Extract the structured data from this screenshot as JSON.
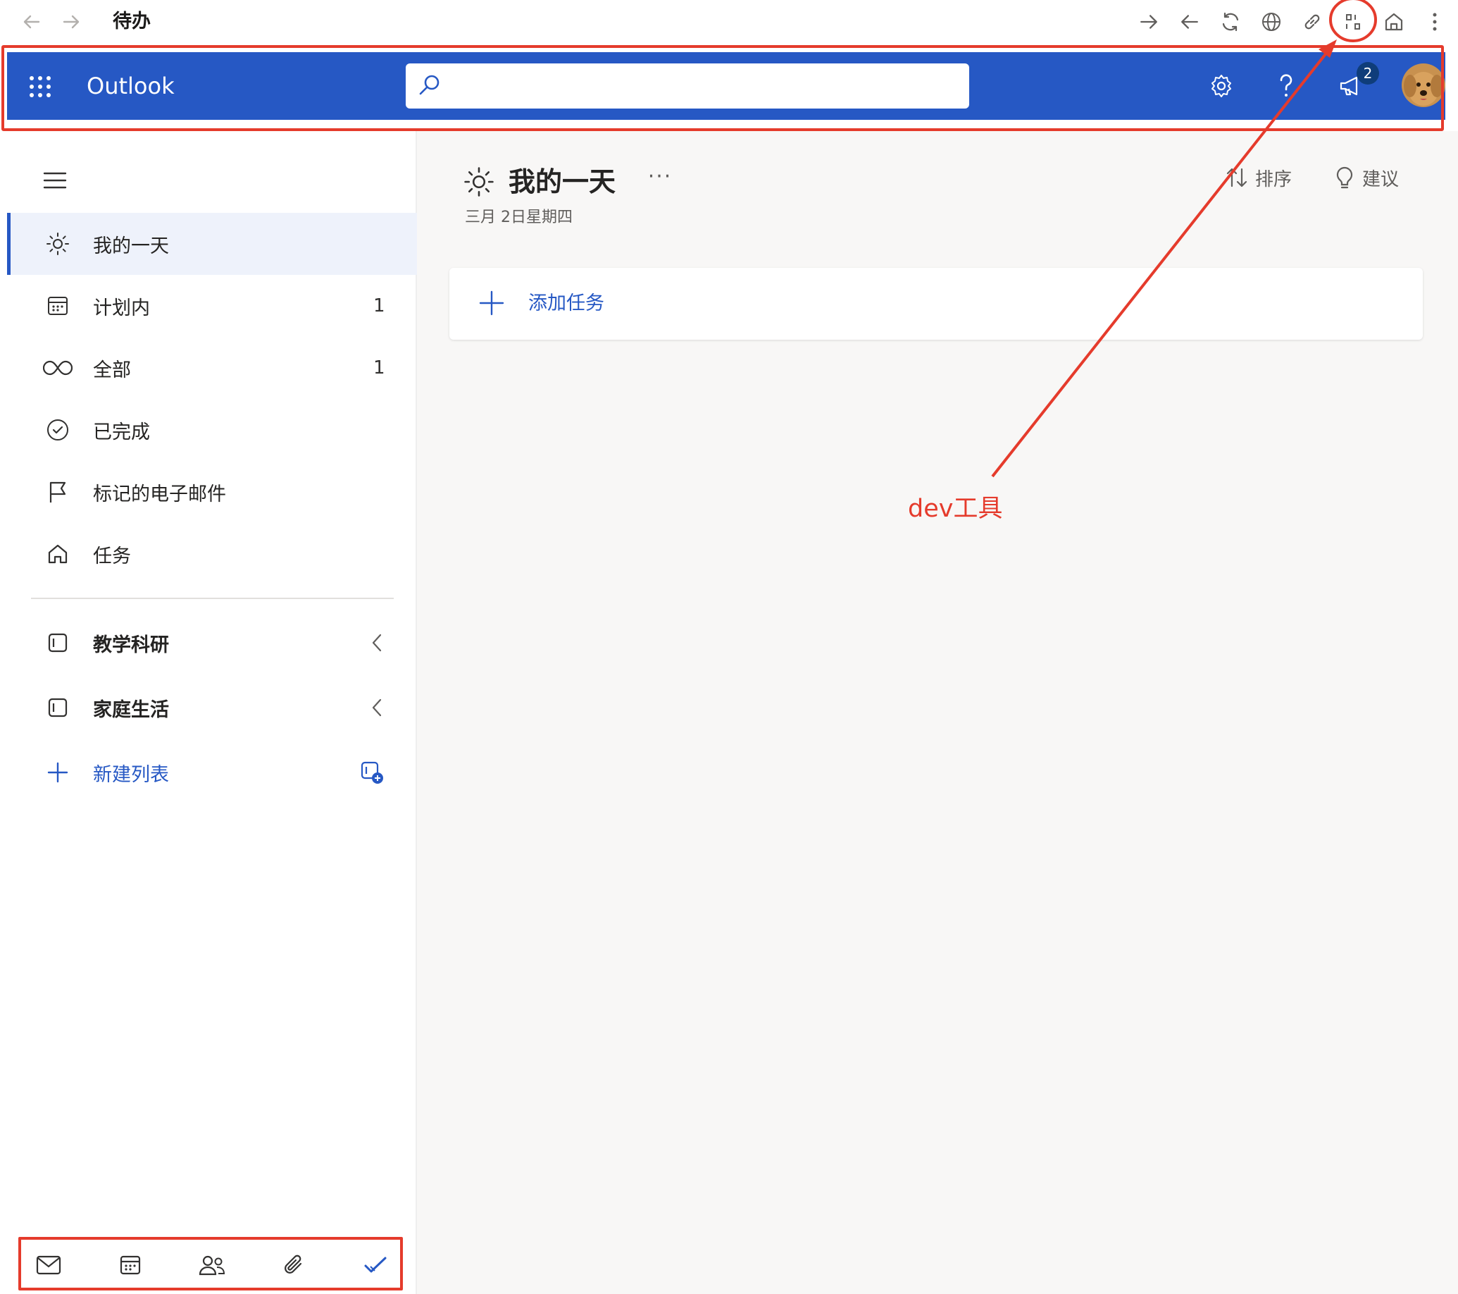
{
  "browser": {
    "title": "待办"
  },
  "header": {
    "app_name": "Outlook",
    "search_placeholder": "",
    "notification_count": "2"
  },
  "sidebar": {
    "smart_lists": [
      {
        "label": "我的一天",
        "count": "",
        "icon": "sun-icon",
        "active": true
      },
      {
        "label": "计划内",
        "count": "1",
        "icon": "calendar-grid-icon"
      },
      {
        "label": "全部",
        "count": "1",
        "icon": "infinity-icon"
      },
      {
        "label": "已完成",
        "count": "",
        "icon": "check-circle-icon"
      },
      {
        "label": "标记的电子邮件",
        "count": "",
        "icon": "flag-icon"
      },
      {
        "label": "任务",
        "count": "",
        "icon": "home-icon"
      }
    ],
    "groups": [
      {
        "label": "教学科研",
        "icon": "group-icon"
      },
      {
        "label": "家庭生活",
        "icon": "group-icon"
      }
    ],
    "new_list_label": "新建列表",
    "app_bar": [
      "mail-icon",
      "calendar-icon",
      "people-icon",
      "attachment-icon",
      "todo-check-icon"
    ]
  },
  "main": {
    "title": "我的一天",
    "more": "···",
    "date": "三月 2日星期四",
    "sort_label": "排序",
    "suggest_label": "建议",
    "add_task_label": "添加任务"
  },
  "annotation": {
    "label": "dev工具",
    "color": "#e53b2c"
  },
  "colors": {
    "brand_blue": "#2658c4",
    "annotation_red": "#e53b2c"
  }
}
